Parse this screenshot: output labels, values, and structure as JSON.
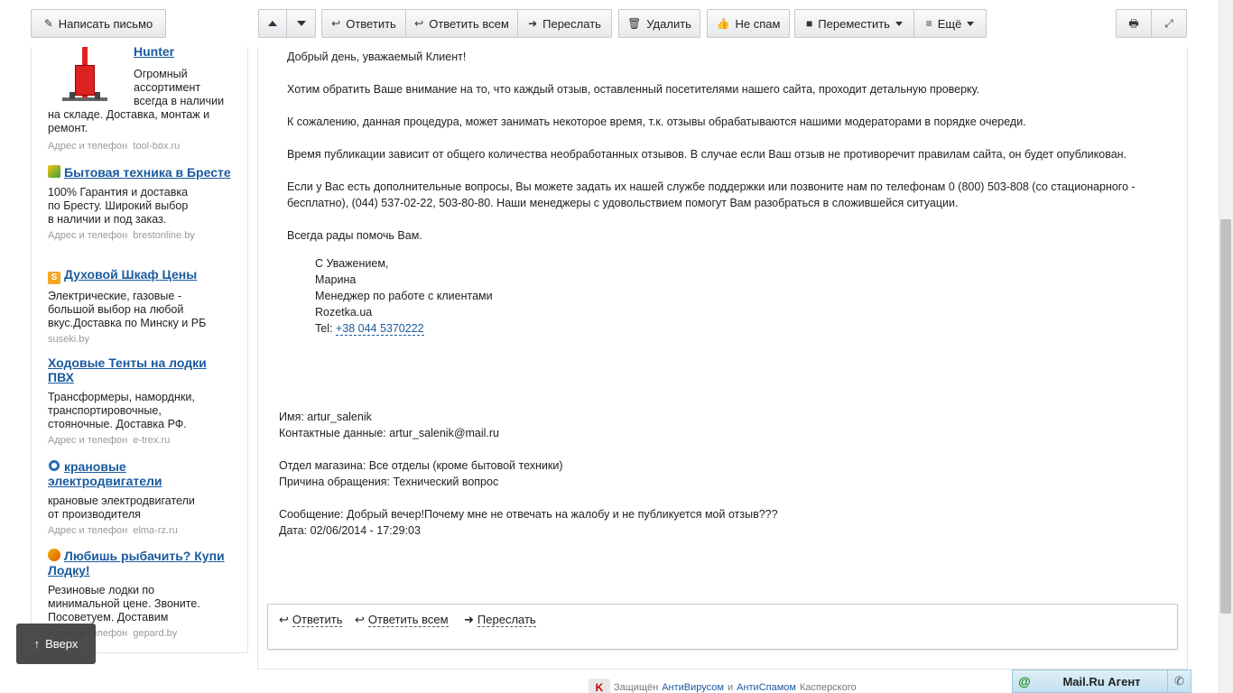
{
  "toolbar": {
    "compose": "Написать письмо",
    "reply": "Ответить",
    "reply_all": "Ответить всем",
    "forward": "Переслать",
    "delete": "Удалить",
    "not_spam": "Не спам",
    "move": "Переместить",
    "more": "Ещё"
  },
  "ads": [
    {
      "title": "Hunter",
      "desc": "Огромный ассортимент всегда в наличии на складе. Доставка, монтаж и ремонт.",
      "meta_label": "Адрес и телефон",
      "domain": "tool-box.ru"
    },
    {
      "title": "Бытовая техника в Бресте",
      "desc": "100% Гарантия и доставка по Бресту. Широкий выбор в наличии и под заказ.",
      "meta_label": "Адрес и телефон",
      "domain": "brestonline.by"
    },
    {
      "title": "Духовой Шкаф Цены",
      "desc": "Электрические, газовые - большой выбор на любой вкус.Доставка по Минску и РБ",
      "meta_label": "",
      "domain": "suseki.by"
    },
    {
      "title": "Ходовые Тенты на лодки ПВХ",
      "desc": "Трансформеры, наморднки, транспортировочные, стояночные. Доставка РФ.",
      "meta_label": "Адрес и телефон",
      "domain": "e-trex.ru"
    },
    {
      "title": "крановые электродвигатели",
      "desc": "крановые электродвигатели от производителя",
      "meta_label": "Адрес и телефон",
      "domain": "elma-rz.ru"
    },
    {
      "title": "Любишь рыбачить? Купи Лодку!",
      "desc": "Резиновые лодки по минимальной цене. Звоните. Посоветуем. Доставим",
      "meta_label": "Адрес и телефон",
      "domain": "gepard.by"
    }
  ],
  "message": {
    "greeting": "Добрый день, уважаемый Клиент!",
    "p1": "Хотим обратить Ваше внимание на то, что каждый отзыв, оставленный посетителями нашего сайта, проходит детальную проверку.",
    "p2": "К сожалению, данная процедура, может занимать некоторое время, т.к. отзывы обрабатываются нашими модераторами в порядке очереди.",
    "p3": "Время публикации зависит от общего количества необработанных отзывов. В случае если Ваш отзыв не противоречит правилам сайта, он будет опубликован.",
    "p4_line1": "Если у Вас есть дополнительные вопросы, Вы можете задать их нашей службе поддержки или позвоните нам по телефонам 0 (800) 503-808 (со стационарного -",
    "p4_line2": "бесплатно), (044) 537-02-22, 503-80-80. Наши менеджеры с удовольствием помогут Вам разобраться в сложившейся ситуации.",
    "p5": "Всегда рады помочь Вам.",
    "sig_regards": "С Уважением,",
    "sig_name": "Марина",
    "sig_role": "Менеджер по работе с клиентами",
    "sig_company": "Rozetka.ua",
    "sig_tel_label": "Tel:",
    "sig_tel": "+38 044 5370222",
    "form_name": "Имя: artur_salenik",
    "form_contact": "Контактные данные: artur_salenik@mail.ru",
    "form_dept": "Отдел магазина: Все отделы (кроме бытовой техники)",
    "form_reason": "Причина обращения: Технический вопрос",
    "form_message": "Сообщение: Добрый вечер!Почему мне не отвечать на жалобу и не публикуется мой отзыв???",
    "form_date": "Дата: 02/06/2014 - 17:29:03"
  },
  "replybar": {
    "reply": "Ответить",
    "reply_all": "Ответить всем",
    "forward": "Переслать"
  },
  "up_button": "Вверх",
  "agent": {
    "name": "Mail.Ru Агент"
  },
  "footer": {
    "prefix": "Защищён",
    "link1": "АнтиВирусом",
    "and": "и",
    "link2": "АнтиСпамом",
    "suffix": "Касперского"
  },
  "colors": {
    "link": "#1a5a9e",
    "agent_bg": "#c2e0ef",
    "up_button_bg": "#3c3c3c"
  }
}
